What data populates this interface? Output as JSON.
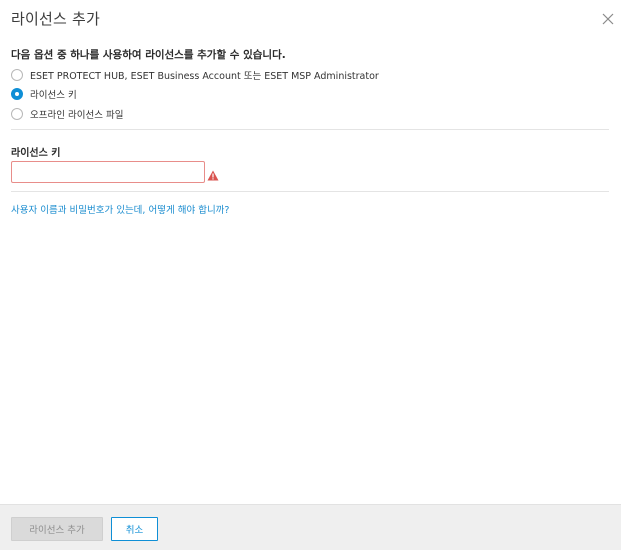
{
  "dialog": {
    "title": "라이선스 추가",
    "close_icon": "close-icon"
  },
  "options": {
    "prompt": "다음 옵션 중 하나를 사용하여 라이선스를 추가할 수 있습니다.",
    "items": [
      {
        "label": "ESET PROTECT HUB, ESET Business Account 또는 ESET MSP Administrator",
        "checked": false
      },
      {
        "label": "라이선스 키",
        "checked": true
      },
      {
        "label": "오프라인 라이선스 파일",
        "checked": false
      }
    ]
  },
  "license_key": {
    "label": "라이선스 키",
    "value": "",
    "warning_icon": "warning-icon",
    "error_color": "#d9534f"
  },
  "help_link": "사용자 이름과 비밀번호가 있는데, 어떻게 해야 합니까?",
  "footer": {
    "add_label": "라이선스 추가",
    "cancel_label": "취소"
  },
  "colors": {
    "accent": "#0f8fd6",
    "link": "#1a8ccf",
    "footer_bg": "#efefef"
  }
}
